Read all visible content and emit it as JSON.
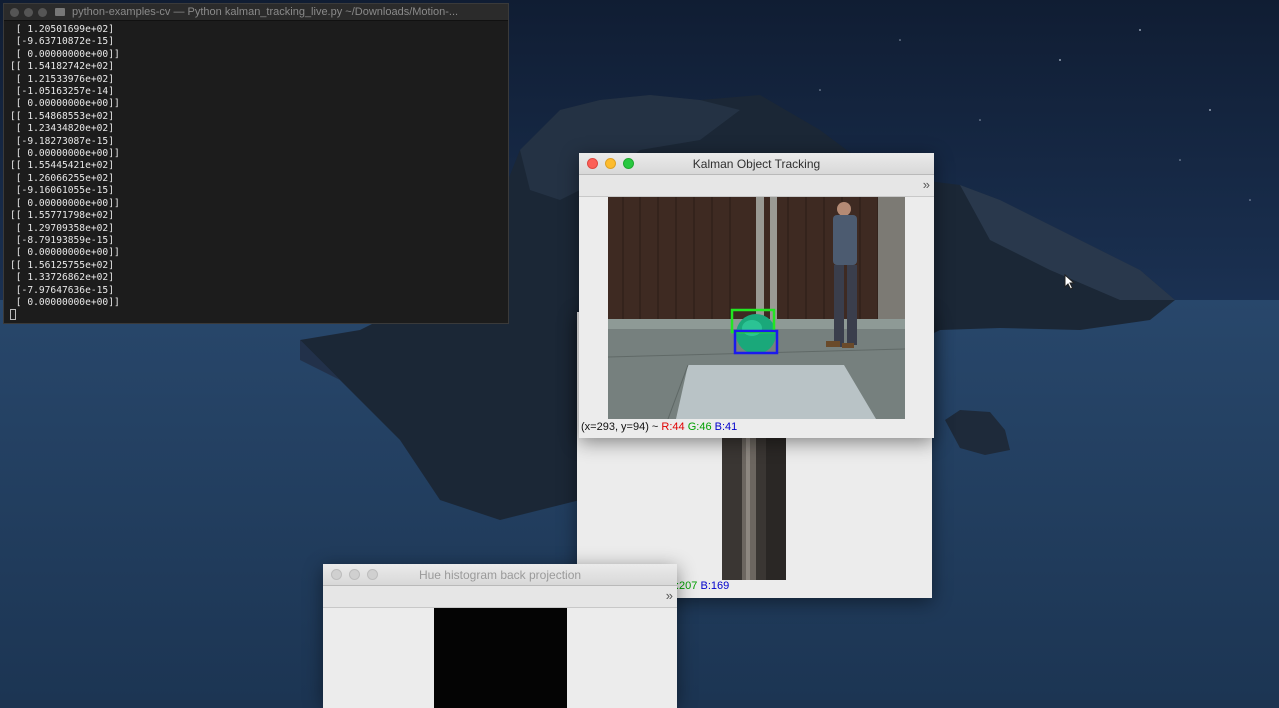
{
  "terminal": {
    "title": "python-examples-cv — Python kalman_tracking_live.py ~/Downloads/Motion-...",
    "lines": [
      " [ 1.20501699e+02]",
      " [-9.63710872e-15]",
      " [ 0.00000000e+00]]",
      "[[ 1.54182742e+02]",
      " [ 1.21533976e+02]",
      " [-1.05163257e-14]",
      " [ 0.00000000e+00]]",
      "[[ 1.54868553e+02]",
      " [ 1.23434820e+02]",
      " [-9.18273087e-15]",
      " [ 0.00000000e+00]]",
      "[[ 1.55445421e+02]",
      " [ 1.26066255e+02]",
      " [-9.16061055e-15]",
      " [ 0.00000000e+00]]",
      "[[ 1.55771798e+02]",
      " [ 1.29709358e+02]",
      " [-8.79193859e-15]",
      " [ 0.00000000e+00]]",
      "[[ 1.56125755e+02]",
      " [ 1.33726862e+02]",
      " [-7.97647636e-15]",
      " [ 0.00000000e+00]]"
    ]
  },
  "kalman_window": {
    "title": "Kalman Object Tracking",
    "more_label": "»",
    "status_coords": "(x=293, y=94) ~",
    "status_r": "R:44",
    "status_g": "G:46",
    "status_b": "B:41"
  },
  "back_window": {
    "status_g": ":207",
    "status_b": "B:169"
  },
  "histogram_window": {
    "title": "Hue histogram back projection",
    "more_label": "»"
  },
  "colors": {
    "red_text": "#e00000",
    "green_text": "#00a000",
    "blue_text": "#0000cc",
    "track_green": "#22e622",
    "track_blue": "#1a1aee"
  }
}
